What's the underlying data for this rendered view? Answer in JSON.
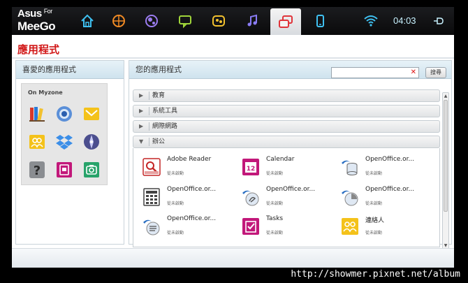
{
  "brand": {
    "line1": "Asus",
    "line1_small": "For",
    "line2": "MeeGo"
  },
  "topbar": {
    "zones": [
      {
        "name": "home-icon"
      },
      {
        "name": "web-icon"
      },
      {
        "name": "media-icon"
      },
      {
        "name": "chat-icon"
      },
      {
        "name": "people-icon"
      },
      {
        "name": "music-icon"
      },
      {
        "name": "apps-icon",
        "active": true
      },
      {
        "name": "device-icon"
      }
    ],
    "clock": "04:03"
  },
  "page": {
    "title": "應用程式"
  },
  "favorites": {
    "header": "喜愛的應用程式",
    "zone_label": "On Myzone",
    "icons": [
      "books-icon",
      "chromium-icon",
      "mail-icon",
      "contacts-icon",
      "dropbox-icon",
      "compass-icon",
      "help-icon",
      "photo-app-icon",
      "camera-icon"
    ]
  },
  "apps_panel": {
    "header": "您的應用程式",
    "search": {
      "value": "",
      "placeholder": ""
    },
    "search_button": "搜尋",
    "categories": [
      {
        "label": "教育",
        "expanded": false
      },
      {
        "label": "系統工具",
        "expanded": false
      },
      {
        "label": "網際網路",
        "expanded": false
      },
      {
        "label": "辦公",
        "expanded": true
      }
    ],
    "office_apps": [
      {
        "name": "Adobe Reader",
        "status": "從未啟動",
        "icon": "adobe-reader-icon"
      },
      {
        "name": "Calendar",
        "status": "從未啟動",
        "icon": "calendar-icon"
      },
      {
        "name": "OpenOffice.or...",
        "status": "從未啟動",
        "icon": "openoffice-base-icon"
      },
      {
        "name": "OpenOffice.or...",
        "status": "從未啟動",
        "icon": "openoffice-calc-icon"
      },
      {
        "name": "OpenOffice.or...",
        "status": "從未啟動",
        "icon": "openoffice-draw-icon"
      },
      {
        "name": "OpenOffice.or...",
        "status": "從未啟動",
        "icon": "openoffice-impress-icon"
      },
      {
        "name": "OpenOffice.or...",
        "status": "從未啟動",
        "icon": "openoffice-writer-icon"
      },
      {
        "name": "Tasks",
        "status": "從未啟動",
        "icon": "tasks-icon"
      },
      {
        "name": "連絡人",
        "status": "從未啟動",
        "icon": "contacts-app-icon"
      }
    ],
    "calendar_day": "12"
  },
  "watermark": "http://showmer.pixnet.net/album",
  "colors": {
    "title_red": "#d11717",
    "clock": "#c8f2ff",
    "header_blue": "#cfe3ee"
  }
}
